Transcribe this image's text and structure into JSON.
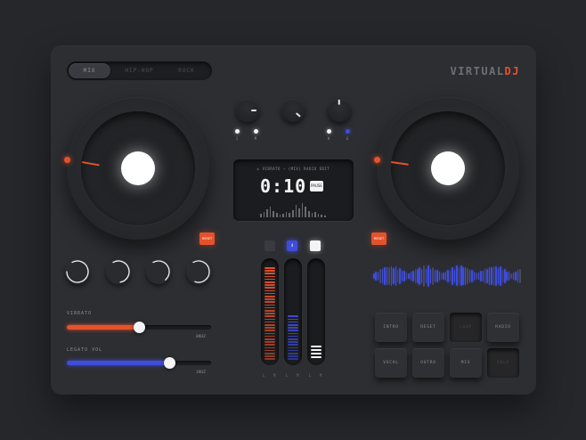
{
  "tabs": [
    {
      "label": "MIX",
      "active": true
    },
    {
      "label": "HIP-HOP",
      "active": false
    },
    {
      "label": "ROCK",
      "active": false
    }
  ],
  "logo": {
    "part1": "VIRTUAL",
    "part2": "DJ"
  },
  "knob_labels": {
    "l1": "1",
    "l2": "M",
    "r1": "H",
    "r2": "G"
  },
  "screen": {
    "track": "►  VIBRATO – (MIX) RADIO EDIT",
    "time": "0:10",
    "play_label": "PAUSE"
  },
  "reset_label": "RESET",
  "sliders": [
    {
      "label": "VIBRATO",
      "value": "8KHZ",
      "fraction": 0.5,
      "color": "#e4522c"
    },
    {
      "label": "LEGATO VOL",
      "value": "1KHZ",
      "fraction": 0.71,
      "color": "#3f4ddb"
    }
  ],
  "faders": [
    {
      "color": "#e4522c",
      "level": 0.92,
      "cap_color": "#3a3b40",
      "cap_label": ""
    },
    {
      "color": "#3f4ddb",
      "level": 0.45,
      "cap_color": "#3f4ddb",
      "cap_label": "4"
    },
    {
      "color": "#f4f4f6",
      "level": 0.12,
      "cap_color": "#f4f4f6",
      "cap_label": ""
    }
  ],
  "fader_labels": [
    "L",
    "M",
    "L",
    "M",
    "L",
    "M"
  ],
  "pads": [
    {
      "label": "INTRO",
      "pressed": false
    },
    {
      "label": "RESET",
      "pressed": false
    },
    {
      "label": "LOOP",
      "pressed": true
    },
    {
      "label": "RADIO",
      "pressed": false
    },
    {
      "label": "VOCAL",
      "pressed": false
    },
    {
      "label": "OUTRO",
      "pressed": false
    },
    {
      "label": "MIX",
      "pressed": false
    },
    {
      "label": "SOLO",
      "pressed": true
    }
  ],
  "colors": {
    "accent_orange": "#e4522c",
    "accent_blue": "#3f4ddb"
  }
}
